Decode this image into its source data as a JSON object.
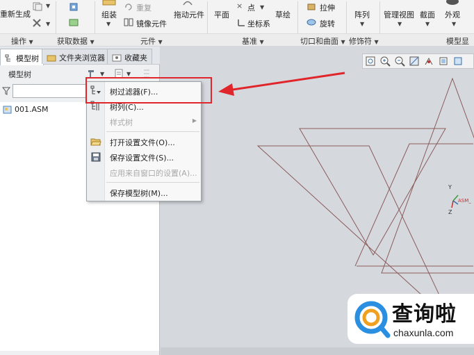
{
  "ribbon": {
    "regenerate": "重新生成",
    "assemble": "组装",
    "redo": "重复",
    "mirror_component": "镜像元件",
    "drag_components": "拖动元件",
    "plane": "平面",
    "point": "点",
    "coord_sys": "坐标系",
    "sketch": "草绘",
    "extrude": "拉伸",
    "revolve": "旋转",
    "pattern": "阵列",
    "manage_views": "管理视图",
    "section": "截面",
    "appearance": "外观",
    "groups": {
      "operations": "操作",
      "get_data": "获取数据",
      "component": "元件",
      "datum": "基准",
      "cut_surface": "切口和曲面",
      "modifiers": "修饰符",
      "model_display": "模型显"
    }
  },
  "left_panel": {
    "tabs": [
      "模型树",
      "文件夹浏览器",
      "收藏夹"
    ],
    "tree_header": "模型树",
    "filter_placeholder": "",
    "tree_items": [
      {
        "label": "001.ASM"
      }
    ]
  },
  "menu": {
    "items": [
      {
        "label": "树过滤器(F)...",
        "enabled": true,
        "icon": "tree-filter-icon"
      },
      {
        "label": "树列(C)...",
        "enabled": true,
        "icon": "tree-columns-icon"
      },
      {
        "label": "样式树",
        "enabled": false,
        "icon": "none",
        "submenu": true
      },
      {
        "label": "打开设置文件(O)...",
        "enabled": true,
        "icon": "folder-open-icon"
      },
      {
        "label": "保存设置文件(S)...",
        "enabled": true,
        "icon": "save-icon"
      },
      {
        "label": "应用来自窗口的设置(A)...",
        "enabled": false,
        "icon": "none"
      },
      {
        "label": "保存模型树(M)...",
        "enabled": true,
        "icon": "none"
      }
    ]
  },
  "graphics": {
    "csys_labels": {
      "y": "Y",
      "z": "Z",
      "asm": "ASM_"
    }
  },
  "watermark": {
    "title": "查询啦",
    "url": "chaxunla.com"
  },
  "colors": {
    "highlight": "#e0262a",
    "sketch_lines": "#8b5a5a"
  }
}
